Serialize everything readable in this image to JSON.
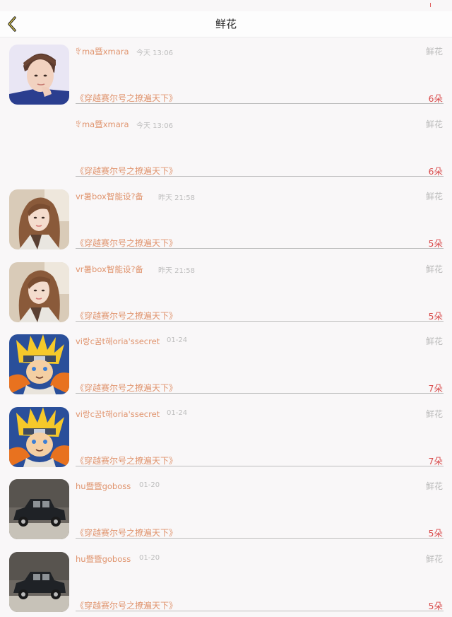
{
  "nav": {
    "title": "鲜花"
  },
  "rows": [
    {
      "avatar": "boy-photo-avatar",
      "username": "ꃰma暨xmara",
      "time": "今天 13:06",
      "type": "鲜花",
      "book": "《穿越赛尔号之撩遍天下》",
      "count": "6朵"
    },
    {
      "avatar": "none",
      "username": "ꃰma暨xmara",
      "time": "今天 13:06",
      "type": "鲜花",
      "book": "《穿越赛尔号之撩遍天下》",
      "count": "6朵"
    },
    {
      "avatar": "girl-photo-avatar",
      "username": "vr暑box智能设?备",
      "time": "昨天 21:58",
      "type": "鲜花",
      "book": "《穿越赛尔号之撩遍天下》",
      "count": "5朵"
    },
    {
      "avatar": "girl-photo-avatar",
      "username": "vr暑box智能设?备",
      "time": "昨天 21:58",
      "type": "鲜花",
      "book": "《穿越赛尔号之撩遍天下》",
      "count": "5朵"
    },
    {
      "avatar": "naruto-avatar",
      "username": "vi랑c꿈t해oria'ssecret",
      "time": "01-24",
      "type": "鲜花",
      "book": "《穿越赛尔号之撩遍天下》",
      "count": "7朵"
    },
    {
      "avatar": "naruto-avatar",
      "username": "vi랑c꿈t해oria'ssecret",
      "time": "01-24",
      "type": "鲜花",
      "book": "《穿越赛尔号之撩遍天下》",
      "count": "7朵"
    },
    {
      "avatar": "vintage-car-avatar",
      "username": "hu暨暨goboss",
      "time": "01-20",
      "type": "鲜花",
      "book": "《穿越赛尔号之撩遍天下》",
      "count": "5朵"
    },
    {
      "avatar": "vintage-car-avatar",
      "username": "hu暨暨goboss",
      "time": "01-20",
      "type": "鲜花",
      "book": "《穿越赛尔号之撩遍天下》",
      "count": "5朵"
    }
  ],
  "colors": {
    "accent": "#e0946e",
    "count": "#d94b4b",
    "muted": "#bdbdbd",
    "background": "#f9f7f8"
  }
}
